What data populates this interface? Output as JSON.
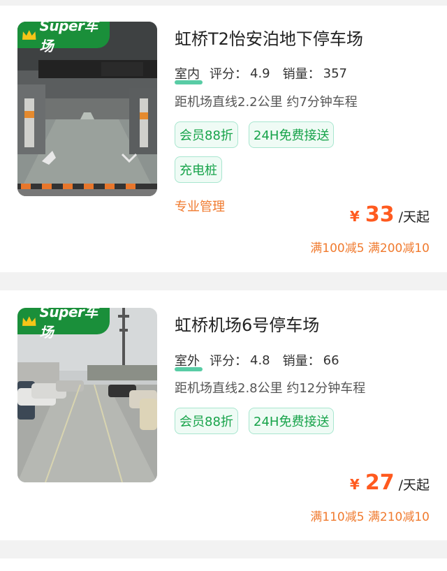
{
  "lots": [
    {
      "badge": "Super车场",
      "title": "虹桥T2怡安泊地下停车场",
      "environment": "室内",
      "rating_label": "评分：",
      "rating": "4.9",
      "sales_label": "销量：",
      "sales": "357",
      "distance": "距机场直线2.2公里 约7分钟车程",
      "tags": [
        "会员88折",
        "24H免费接送",
        "充电桩"
      ],
      "management": "专业管理",
      "currency": "¥",
      "price": "33",
      "price_unit": "/天起",
      "promotion": "满100减5 满200减10"
    },
    {
      "badge": "Super车场",
      "title": "虹桥机场6号停车场",
      "environment": "室外",
      "rating_label": "评分：",
      "rating": "4.8",
      "sales_label": "销量：",
      "sales": "66",
      "distance": "距机场直线2.8公里 约12分钟车程",
      "tags": [
        "会员88折",
        "24H免费接送"
      ],
      "currency": "¥",
      "price": "27",
      "price_unit": "/天起",
      "promotion": "满110减5 满210减10"
    }
  ],
  "colors": {
    "badge_green": "#1a8f3a",
    "tag_green": "#17a34a",
    "price_orange": "#ff5a1f",
    "promo_orange": "#f07a2e"
  }
}
